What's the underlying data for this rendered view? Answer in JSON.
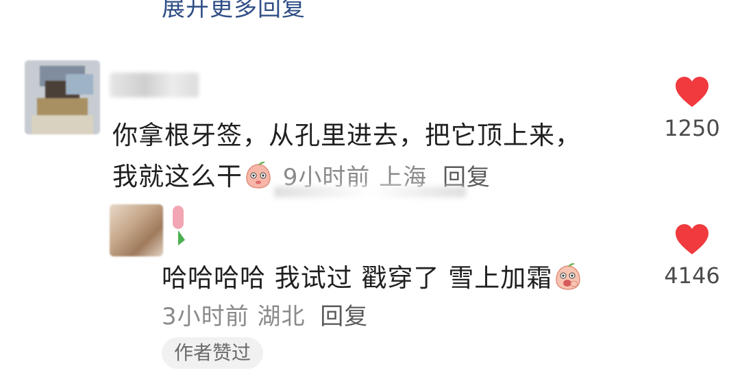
{
  "expand_more": "展开更多回复",
  "comment": {
    "text": "你拿根牙签，从孔里进去，把它顶上来，我就这么干",
    "time": "9小时前",
    "location": "上海",
    "reply_label": "回复",
    "likes": "1250",
    "emoji": "peach-shy-emoji"
  },
  "reply": {
    "text": "哈哈哈哈 我试过 戳穿了 雪上加霜",
    "time": "3小时前",
    "location": "湖北",
    "reply_label": "回复",
    "likes": "4146",
    "author_badge": "作者赞过",
    "emoji": "peach-laugh-emoji"
  },
  "colors": {
    "heart": "#f03a3e",
    "link": "#2f4e86",
    "meta": "#8a8a8a",
    "text": "#1f1f1f"
  }
}
